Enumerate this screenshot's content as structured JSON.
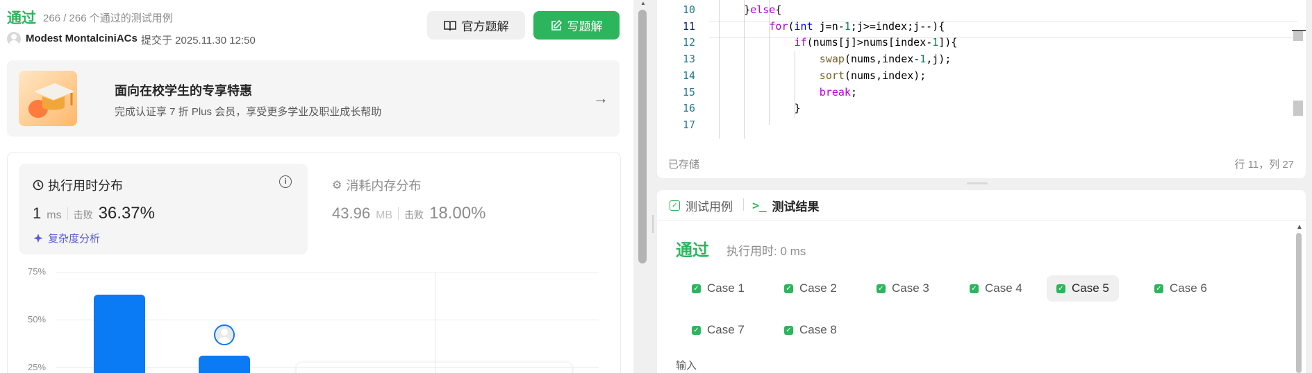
{
  "submission": {
    "status": "通过",
    "count_text": "266 / 266 个通过的测试用例",
    "user": "Modest MontalciniACs",
    "submitted_at": "提交于 2025.11.30 12:50"
  },
  "actions": {
    "official_solution": "官方题解",
    "write_solution": "写题解"
  },
  "promo": {
    "title": "面向在校学生的专享特惠",
    "subtitle": "完成认证享 7 折 Plus 会员，享受更多学业及职业成长帮助"
  },
  "runtime": {
    "heading": "执行用时分布",
    "value": "1",
    "unit": "ms",
    "beat_label": "击败",
    "beat_pct": "36.37%",
    "complexity_link": "复杂度分析"
  },
  "memory": {
    "heading": "消耗内存分布",
    "value": "43.96",
    "unit": "MB",
    "beat_label": "击败",
    "beat_pct": "18.00%"
  },
  "chart_data": {
    "type": "bar",
    "title": "",
    "xlabel": "",
    "ylabel": "",
    "y_ticks": [
      "75%",
      "50%",
      "25%"
    ],
    "ylim": [
      0,
      75
    ],
    "values": [
      63,
      31
    ],
    "grid": true,
    "colors": {
      "bar": "#0a7af5"
    }
  },
  "editor": {
    "lines": [
      {
        "n": "10",
        "indent": 4,
        "segments": [
          [
            "p",
            "}"
          ],
          [
            "kw",
            "else"
          ],
          [
            "p",
            "{"
          ]
        ]
      },
      {
        "n": "11",
        "indent": 8,
        "segments": [
          [
            "kw",
            "for"
          ],
          [
            "p",
            "("
          ],
          [
            "ty",
            "int"
          ],
          [
            "p",
            " j=n-"
          ],
          [
            "num",
            "1"
          ],
          [
            "p",
            ";j>=index;j--){"
          ]
        ]
      },
      {
        "n": "12",
        "indent": 12,
        "segments": [
          [
            "kw",
            "if"
          ],
          [
            "p",
            "(nums[j]>nums[index-"
          ],
          [
            "num",
            "1"
          ],
          [
            "p",
            "]){"
          ]
        ]
      },
      {
        "n": "13",
        "indent": 16,
        "segments": [
          [
            "fn",
            "swap"
          ],
          [
            "p",
            "(nums,index-"
          ],
          [
            "num",
            "1"
          ],
          [
            "p",
            ",j);"
          ]
        ]
      },
      {
        "n": "14",
        "indent": 16,
        "segments": [
          [
            "fn",
            "sort"
          ],
          [
            "p",
            "(nums,index);"
          ]
        ]
      },
      {
        "n": "15",
        "indent": 16,
        "segments": [
          [
            "kw",
            "break"
          ],
          [
            "p",
            ";"
          ]
        ]
      },
      {
        "n": "16",
        "indent": 12,
        "segments": [
          [
            "p",
            "}"
          ]
        ]
      },
      {
        "n": "17",
        "indent": 0,
        "segments": []
      }
    ],
    "saved_status": "已存储",
    "cursor_pos": "行 11，列 27"
  },
  "results": {
    "tab_cases": "测试用例",
    "tab_result": "测试结果",
    "status": "通过",
    "runtime": "执行用时: 0 ms",
    "cases": [
      "Case 1",
      "Case 2",
      "Case 3",
      "Case 4",
      "Case 5",
      "Case 6",
      "Case 7",
      "Case 8"
    ],
    "active_case": "Case 5",
    "input_label": "输入"
  },
  "colors": {
    "accent_green": "#2db55d",
    "accent_blue": "#0a7af5",
    "link_purple": "#5b5bd6"
  }
}
